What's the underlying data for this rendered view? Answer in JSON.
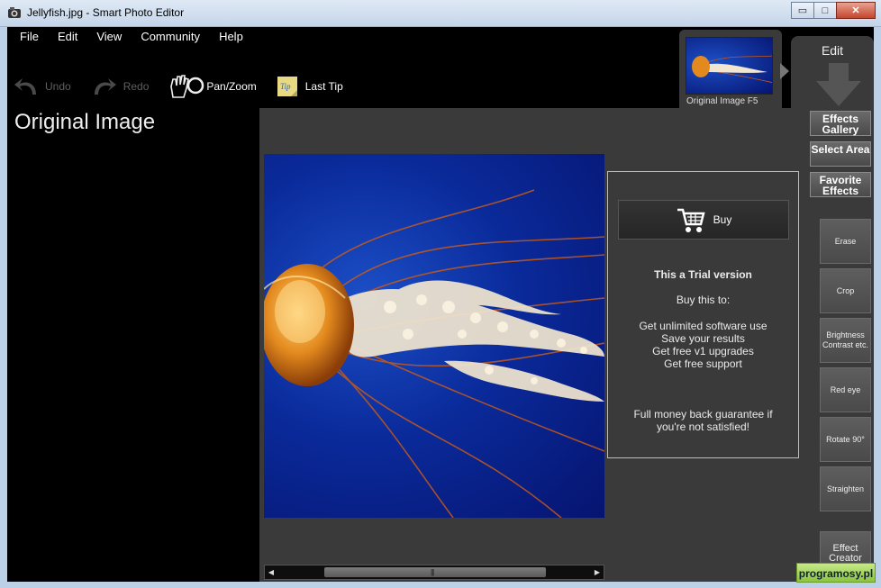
{
  "window": {
    "title": "Jellyfish.jpg - Smart Photo Editor",
    "controls": {
      "minimize": "▭",
      "maximize": "□",
      "close": "✕"
    }
  },
  "menu": [
    "File",
    "Edit",
    "View",
    "Community",
    "Help"
  ],
  "toolbar": {
    "undo": "Undo",
    "redo": "Redo",
    "pan_zoom": "Pan/Zoom",
    "last_tip": "Last Tip",
    "tip_icon_text": "Tip"
  },
  "section_title": "Original Image",
  "history": {
    "label": "Original Image F5"
  },
  "edit_tab": {
    "label": "Edit"
  },
  "nav_buttons": [
    {
      "label": "Effects Gallery"
    },
    {
      "label": "Select Area"
    },
    {
      "label": "Favorite Effects"
    }
  ],
  "tools": [
    {
      "label": "Erase"
    },
    {
      "label": "Crop"
    },
    {
      "label": "Brightness Contrast etc."
    },
    {
      "label": "Red eye"
    },
    {
      "label": "Rotate 90°"
    },
    {
      "label": "Straighten"
    },
    {
      "label": "Effect Creator"
    }
  ],
  "trial": {
    "buy": "Buy",
    "title": "This a Trial version",
    "subtitle": "Buy this to:",
    "benefits": [
      "Get unlimited software use",
      "Save your results",
      "Get free v1 upgrades",
      "Get free support"
    ],
    "guarantee": "Full money back guarantee if you're not satisfied!"
  },
  "scrollbar": {
    "left_arrow": "◀",
    "right_arrow": "▶",
    "grip": "|||"
  },
  "watermark": "programosy.pl",
  "colors": {
    "panel": "#3a3a3a",
    "background": "#000000",
    "photo_blue": "#0a2a9a",
    "jelly_orange": "#e38a1e"
  },
  "icons": [
    "app-icon",
    "undo-icon",
    "redo-icon",
    "pan-zoom-icon",
    "tip-icon",
    "cart-icon",
    "down-arrow-icon",
    "next-arrow-icon"
  ]
}
